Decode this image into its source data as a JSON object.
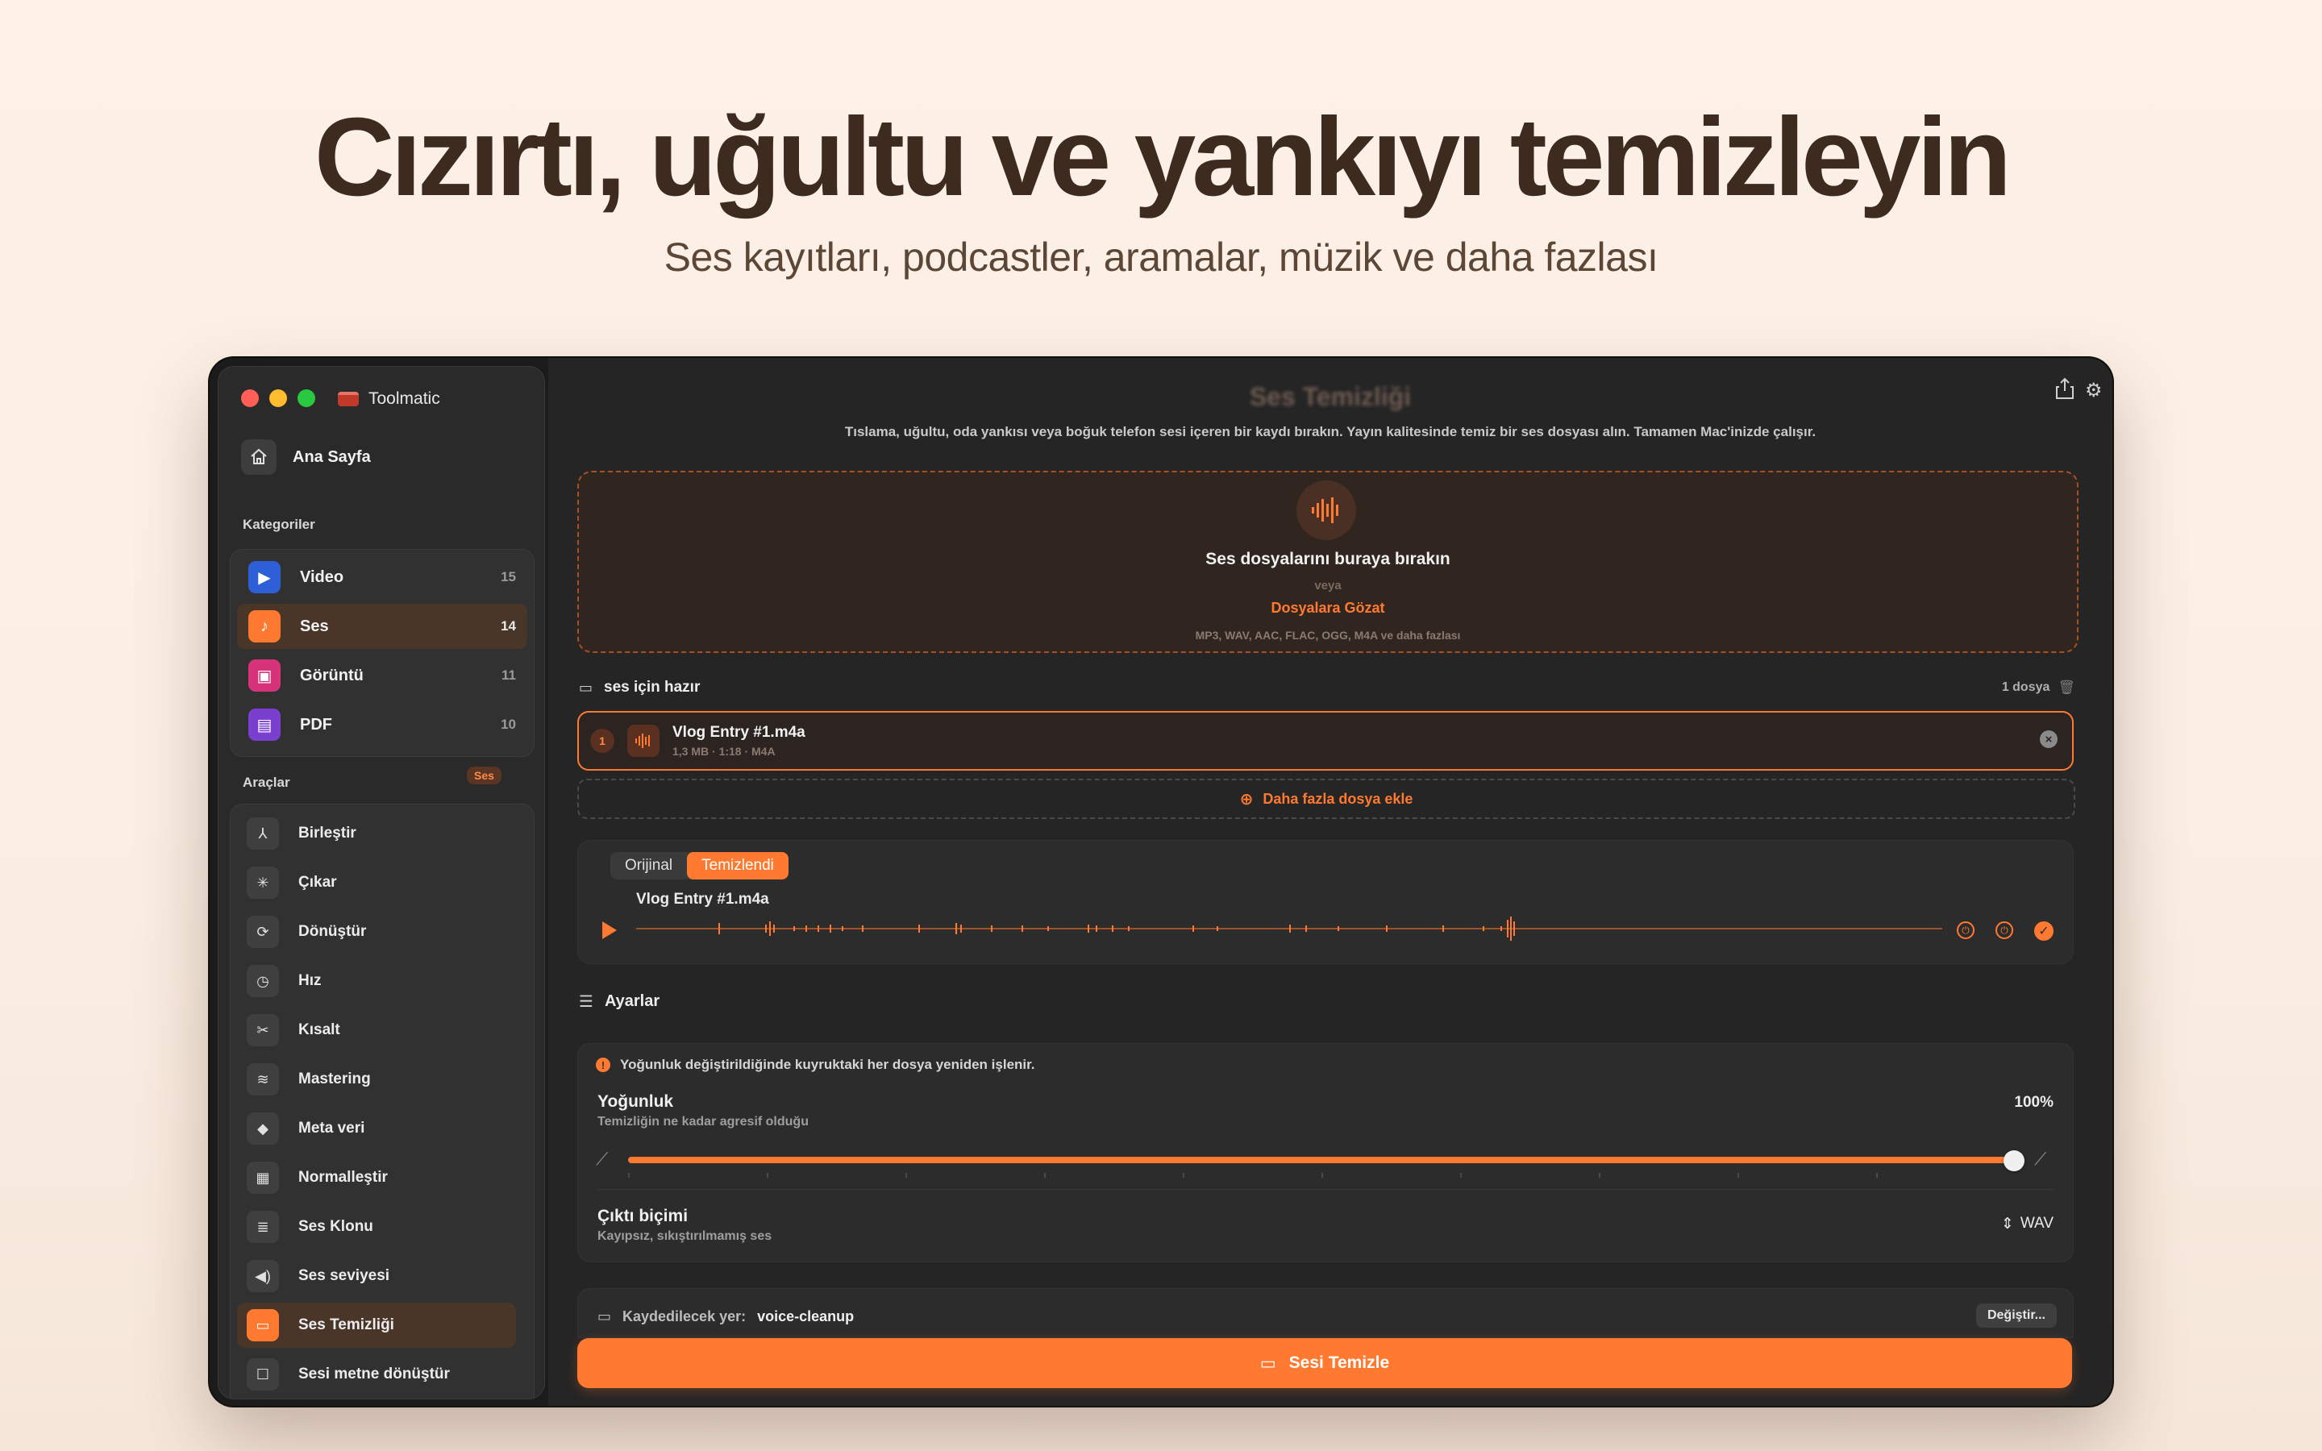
{
  "hero": {
    "title": "Cızırtı, uğultu ve yankıyı temizleyin",
    "subtitle": "Ses kayıtları, podcastler, aramalar, müzik ve daha fazlası"
  },
  "window": {
    "app_name": "Toolmatic"
  },
  "sidebar": {
    "home_label": "Ana Sayfa",
    "categories_header": "Kategoriler",
    "categories": [
      {
        "label": "Video",
        "count": "15",
        "icon": "video-icon",
        "color": "#2d5fd6"
      },
      {
        "label": "Ses",
        "count": "14",
        "icon": "music-note-icon",
        "color": "#ff7a30"
      },
      {
        "label": "Görüntü",
        "count": "11",
        "icon": "image-icon",
        "color": "#d6337a"
      },
      {
        "label": "PDF",
        "count": "10",
        "icon": "document-icon",
        "color": "#7b3fd0"
      }
    ],
    "tools_header": "Araçlar",
    "tools_badge": "Ses",
    "tools": [
      {
        "label": "Birleştir",
        "icon": "merge-icon"
      },
      {
        "label": "Çıkar",
        "icon": "extract-icon"
      },
      {
        "label": "Dönüştür",
        "icon": "convert-icon"
      },
      {
        "label": "Hız",
        "icon": "speed-icon"
      },
      {
        "label": "Kısalt",
        "icon": "scissors-icon"
      },
      {
        "label": "Mastering",
        "icon": "mastering-icon"
      },
      {
        "label": "Meta veri",
        "icon": "tag-icon"
      },
      {
        "label": "Normalleştir",
        "icon": "normalize-icon"
      },
      {
        "label": "Ses Klonu",
        "icon": "voice-clone-icon"
      },
      {
        "label": "Ses seviyesi",
        "icon": "volume-icon"
      },
      {
        "label": "Ses Temizliği",
        "icon": "cleanup-icon"
      },
      {
        "label": "Sesi metne dönüştür",
        "icon": "transcribe-icon"
      }
    ]
  },
  "main": {
    "title": "Ses Temizliği",
    "description": "Tıslama, uğultu, oda yankısı veya boğuk telefon sesi içeren bir kaydı bırakın. Yayın kalitesinde temiz bir ses dosyası alın. Tamamen Mac'inizde çalışır.",
    "dropzone": {
      "title": "Ses dosyalarını buraya bırakın",
      "or": "veya",
      "browse": "Dosyalara Gözat",
      "formats": "MP3, WAV, AAC, FLAC, OGG, M4A ve daha fazlası"
    },
    "queue": {
      "label": "ses için hazır",
      "count": "1 dosya",
      "files": [
        {
          "index": "1",
          "name": "Vlog Entry #1.m4a",
          "meta": "1,3 MB · 1:18 · M4A"
        }
      ],
      "add_more": "Daha fazla dosya ekle"
    },
    "player": {
      "tab_original": "Orijinal",
      "tab_cleaned": "Temizlendi",
      "active_tab": "Temizlendi",
      "file_name": "Vlog Entry #1.m4a"
    },
    "settings": {
      "header": "Ayarlar",
      "warning": "Yoğunluk değiştirildiğinde kuyruktaki her dosya yeniden işlenir.",
      "intensity_label": "Yoğunluk",
      "intensity_desc": "Temizliğin ne kadar agresif olduğu",
      "intensity_value": "100%",
      "intensity_fraction": 1.0,
      "output_label": "Çıktı biçimi",
      "output_desc": "Kayıpsız, sıkıştırılmamış ses",
      "output_value": "WAV"
    },
    "save": {
      "label": "Kaydedilecek yer:",
      "value": "voice-cleanup",
      "change_button": "Değiştir..."
    },
    "cta_label": "Sesi Temizle"
  },
  "colors": {
    "accent": "#ff7a30"
  }
}
